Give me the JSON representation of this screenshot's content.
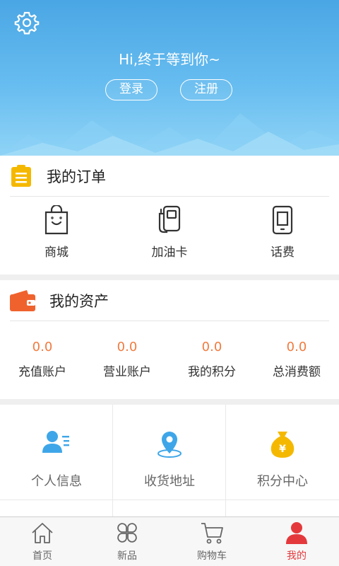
{
  "header": {
    "greeting": "Hi,终于等到你~",
    "login_label": "登录",
    "register_label": "注册",
    "settings_icon": "gear-icon"
  },
  "orders": {
    "title": "我的订单",
    "icon": "clipboard-icon",
    "items": [
      {
        "label": "商城",
        "icon": "shopping-bag-icon"
      },
      {
        "label": "加油卡",
        "icon": "fuel-pump-icon"
      },
      {
        "label": "话费",
        "icon": "mobile-phone-icon"
      }
    ]
  },
  "assets": {
    "title": "我的资产",
    "icon": "wallet-icon",
    "items": [
      {
        "value": "0.0",
        "label": "充值账户"
      },
      {
        "value": "0.0",
        "label": "营业账户"
      },
      {
        "value": "0.0",
        "label": "我的积分"
      },
      {
        "value": "0.0",
        "label": "总消费额"
      }
    ]
  },
  "grid": [
    {
      "label": "个人信息",
      "icon": "user-profile-icon"
    },
    {
      "label": "收货地址",
      "icon": "location-pin-icon"
    },
    {
      "label": "积分中心",
      "icon": "money-bag-icon"
    }
  ],
  "tabbar": [
    {
      "label": "首页",
      "icon": "home-icon",
      "active": false
    },
    {
      "label": "新品",
      "icon": "grid-petals-icon",
      "active": false
    },
    {
      "label": "购物车",
      "icon": "cart-icon",
      "active": false
    },
    {
      "label": "我的",
      "icon": "person-icon",
      "active": true
    }
  ],
  "colors": {
    "header_top": "#4aa6e4",
    "header_bottom": "#8fd3f6",
    "order_icon": "#f5b800",
    "wallet_icon": "#f0622d",
    "asset_value": "#f07b3f",
    "grid_icon_blue": "#3ea6e8",
    "grid_icon_gold": "#f5b800",
    "tab_active": "#e4393c"
  }
}
